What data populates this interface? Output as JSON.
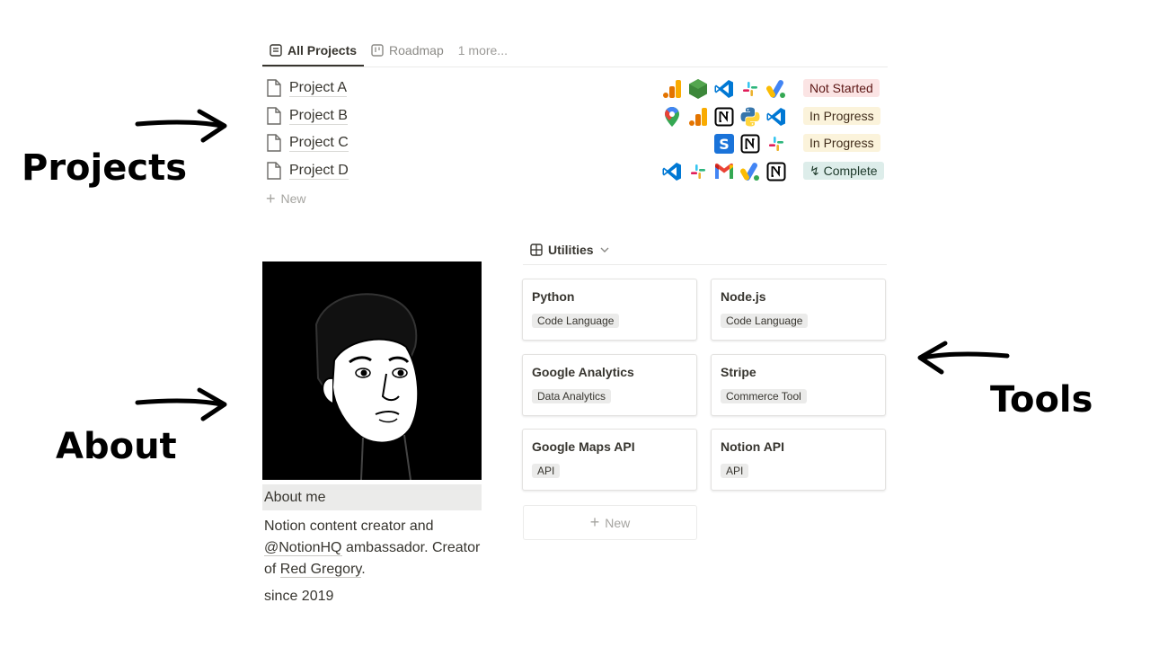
{
  "tabs": [
    {
      "label": "All Projects",
      "icon": "list-icon",
      "active": true
    },
    {
      "label": "Roadmap",
      "icon": "board-icon",
      "active": false
    },
    {
      "label": "1 more...",
      "active": false
    }
  ],
  "projects": [
    {
      "title": "Project A",
      "status": "Not Started",
      "status_color": "#fbe4e4",
      "tools": [
        "google-analytics-icon",
        "nodejs-icon",
        "vscode-icon",
        "slack-icon",
        "google-ads-icon"
      ]
    },
    {
      "title": "Project B",
      "status": "In Progress",
      "status_color": "#fbf3db",
      "tools": [
        "google-maps-icon",
        "google-analytics-icon",
        "notion-icon",
        "python-icon",
        "vscode-icon"
      ]
    },
    {
      "title": "Project C",
      "status": "In Progress",
      "status_color": "#fbf3db",
      "tools": [
        "stripe-icon",
        "notion-icon",
        "slack-icon"
      ]
    },
    {
      "title": "Project D",
      "status": "↯ Complete",
      "status_color": "#ddedea",
      "tools": [
        "vscode-icon",
        "slack-icon",
        "gmail-icon",
        "google-ads-icon",
        "notion-icon"
      ]
    }
  ],
  "projects_new_label": "New",
  "annotations": {
    "projects": "Projects",
    "about": "About",
    "tools": "Tools"
  },
  "about": {
    "header": "About me",
    "text_1": "Notion content creator  and ",
    "link_1": "@NotionHQ",
    "text_2": " ambassador. Creator of ",
    "link_2": "Red Gregory",
    "text_3": ".",
    "since": "since 2019"
  },
  "utilities": {
    "title": "Utilities",
    "cards": [
      {
        "name": "Python",
        "tag": "Code Language"
      },
      {
        "name": "Node.js",
        "tag": "Code Language"
      },
      {
        "name": "Google Analytics",
        "tag": "Data Analytics"
      },
      {
        "name": "Stripe",
        "tag": "Commerce Tool"
      },
      {
        "name": "Google Maps API",
        "tag": "API"
      },
      {
        "name": "Notion API",
        "tag": "API"
      }
    ],
    "new_label": "New"
  }
}
